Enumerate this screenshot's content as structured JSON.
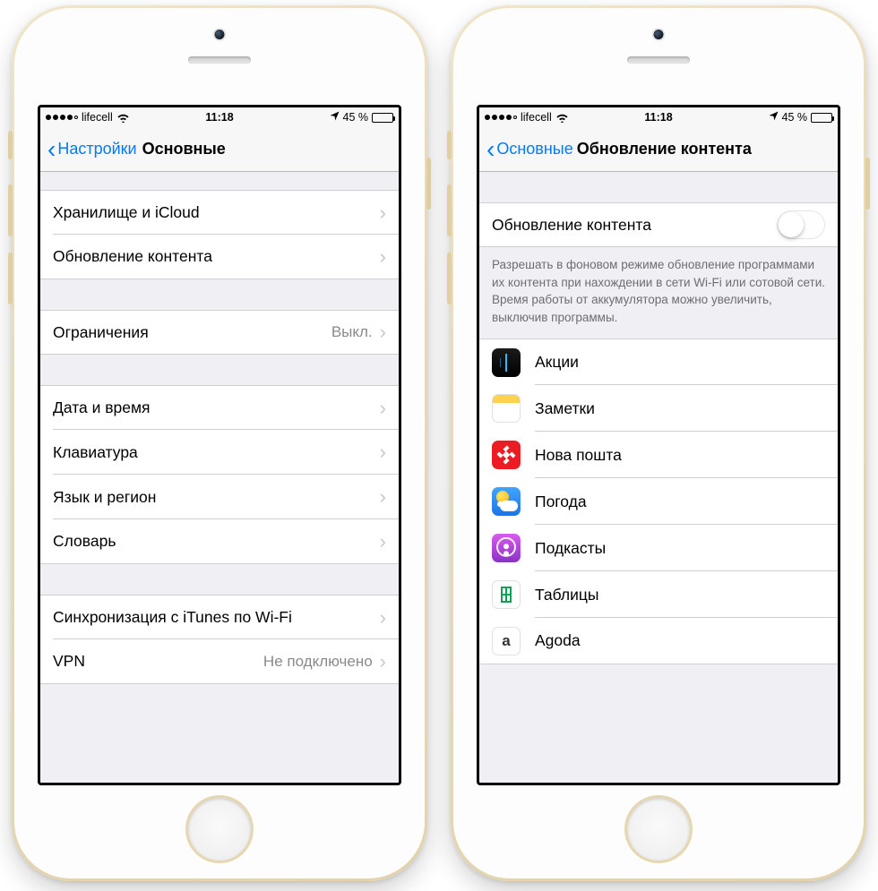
{
  "status": {
    "carrier": "lifecell",
    "time": "11:18",
    "battery_pct": "45 %",
    "signal_filled": 4,
    "battery_fill_pct": 45
  },
  "left": {
    "back_label": "Настройки",
    "title": "Основные",
    "groups": [
      [
        {
          "label": "Хранилище и iCloud"
        },
        {
          "label": "Обновление контента"
        }
      ],
      [
        {
          "label": "Ограничения",
          "value": "Выкл."
        }
      ],
      [
        {
          "label": "Дата и время"
        },
        {
          "label": "Клавиатура"
        },
        {
          "label": "Язык и регион"
        },
        {
          "label": "Словарь"
        }
      ],
      [
        {
          "label": "Синхронизация с iTunes по Wi-Fi"
        },
        {
          "label": "VPN",
          "value": "Не подключено"
        }
      ]
    ]
  },
  "right": {
    "back_label": "Основные",
    "title": "Обновление контента",
    "master_label": "Обновление контента",
    "master_on": false,
    "footer": "Разрешать в фоновом режиме обновление программами их контента при нахождении в сети Wi-Fi или сотовой сети. Время работы от аккумулятора можно увеличить, выключив программы.",
    "apps": [
      {
        "name": "Акции",
        "icon": "stocks"
      },
      {
        "name": "Заметки",
        "icon": "notes"
      },
      {
        "name": "Нова пошта",
        "icon": "novaposhta"
      },
      {
        "name": "Погода",
        "icon": "weather"
      },
      {
        "name": "Подкасты",
        "icon": "podcasts"
      },
      {
        "name": "Таблицы",
        "icon": "sheets"
      },
      {
        "name": "Agoda",
        "icon": "agoda"
      }
    ]
  }
}
